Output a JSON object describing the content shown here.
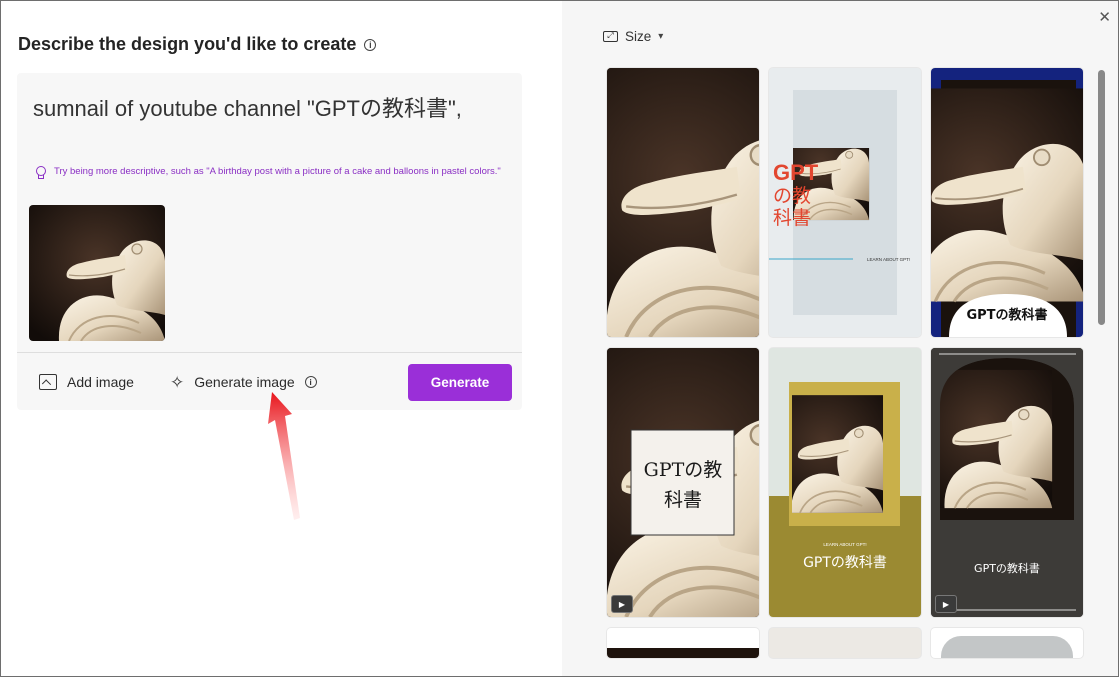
{
  "left_panel": {
    "heading": "Describe the design you'd like to create",
    "prompt_text": "sumnail of youtube channel \"GPTの教科書\",",
    "tip_text": "Try being more descriptive, such as \"A birthday post with a picture of a cake and balloons in pastel colors.\"",
    "add_image_label": "Add image",
    "generate_image_label": "Generate image",
    "generate_button_label": "Generate",
    "accent_color": "#9a2fd8",
    "tip_color": "#8a2fc4",
    "annotation_arrow_color": "#e8141b"
  },
  "right_panel": {
    "size_label": "Size",
    "close_icon": "close-icon",
    "designs": [
      {
        "id": "design-1",
        "style": "photo-full"
      },
      {
        "id": "design-2",
        "style": "red-title",
        "title": "GPTの教科書",
        "caption": "LEARN ABOUT GPT!"
      },
      {
        "id": "design-3",
        "style": "blue-border",
        "title": "GPTの教科書"
      },
      {
        "id": "design-4",
        "style": "card-overlay",
        "title": "GPTの教科書",
        "video": true
      },
      {
        "id": "design-5",
        "style": "olive-frame",
        "title": "GPTの教科書",
        "caption": "LEARN ABOUT GPT!"
      },
      {
        "id": "design-6",
        "style": "dark-arch",
        "title": "GPTの教科書",
        "video": true
      }
    ]
  }
}
